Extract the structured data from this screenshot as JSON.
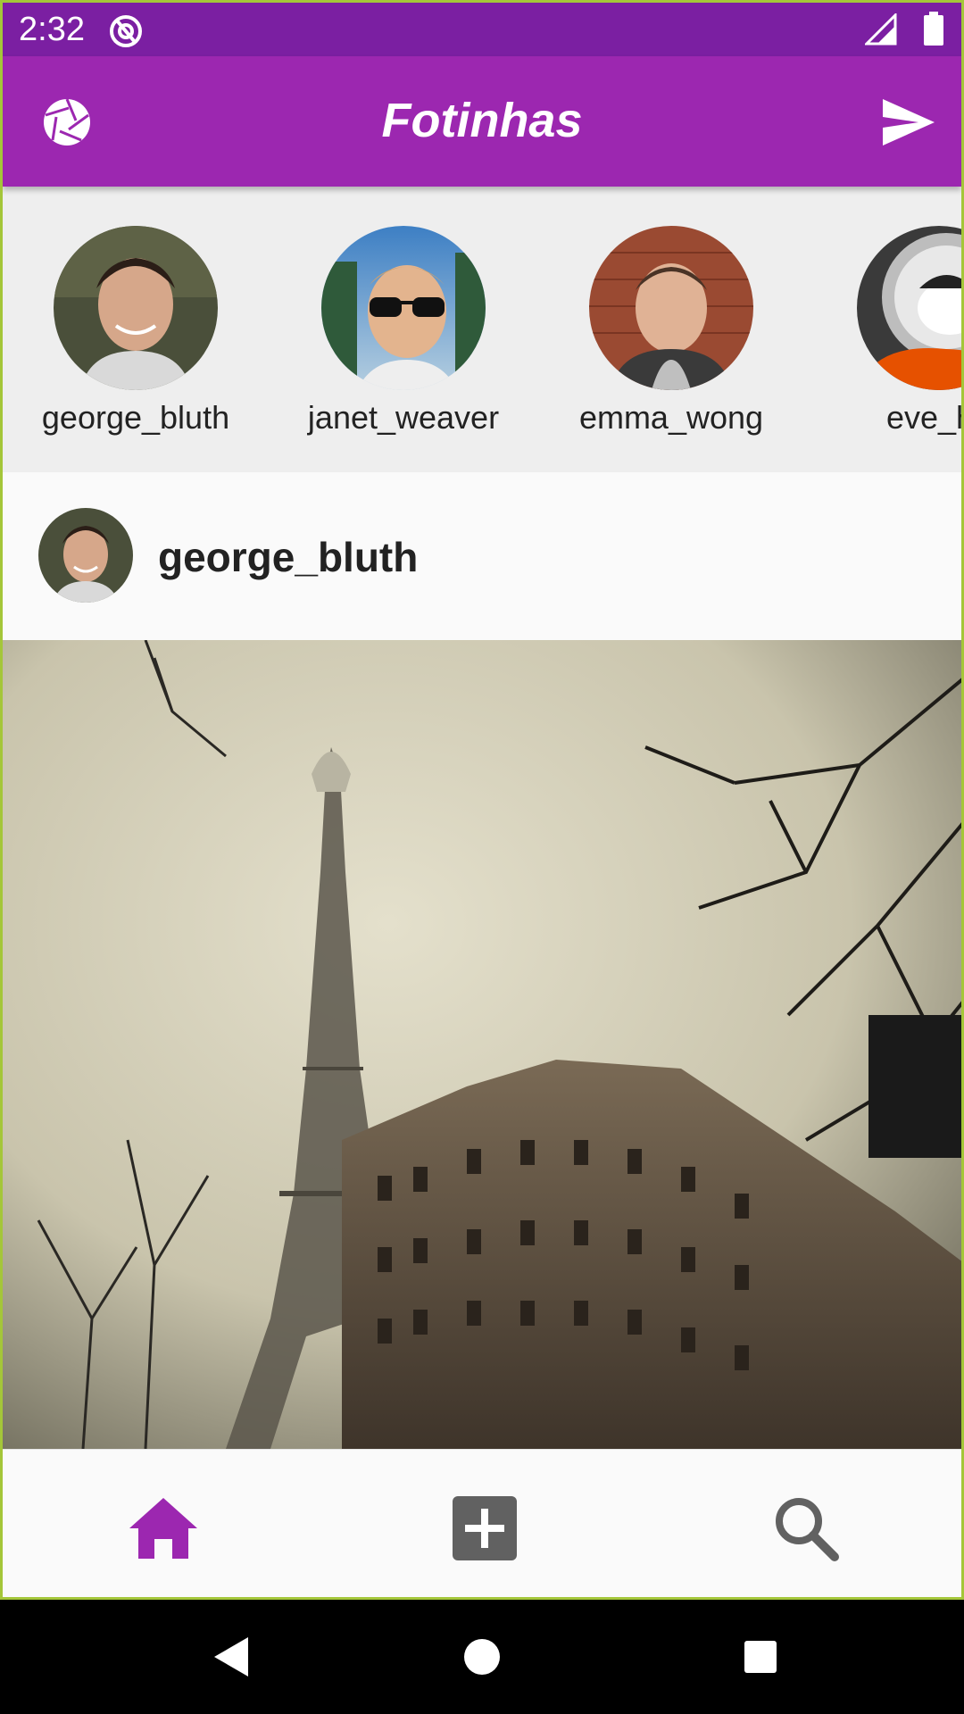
{
  "status_bar": {
    "time": "2:32",
    "icons": [
      "app-notification-icon",
      "cell-signal-icon",
      "battery-icon"
    ]
  },
  "app_bar": {
    "title": "Fotinhas",
    "left_icon": "camera-aperture-icon",
    "right_icon": "send-icon"
  },
  "stories": [
    {
      "username": "george_bluth"
    },
    {
      "username": "janet_weaver"
    },
    {
      "username": "emma_wong"
    },
    {
      "username": "eve_ho"
    }
  ],
  "post": {
    "username": "george_bluth",
    "image": "Eiffel Tower with bare trees and Parisian building"
  },
  "bottom_nav": {
    "items": [
      {
        "icon": "home-icon",
        "active": true
      },
      {
        "icon": "add-box-icon",
        "active": false
      },
      {
        "icon": "search-icon",
        "active": false
      }
    ]
  },
  "colors": {
    "status_bar": "#7b1fa2",
    "primary": "#9c27b0",
    "stories_bg": "#eeeeee",
    "nav_active": "#9c27b0",
    "nav_inactive": "#616161"
  }
}
